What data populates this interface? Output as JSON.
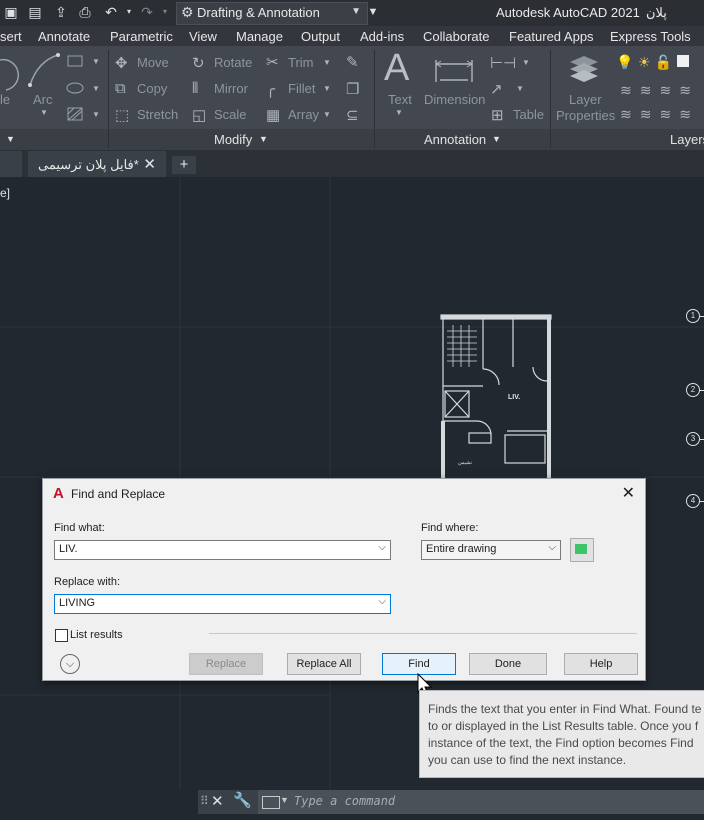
{
  "titlebar": {
    "workspace": "Drafting & Annotation",
    "app_name": "Autodesk AutoCAD 2021",
    "file_title": "پلان ترسیمی"
  },
  "menu": [
    "sert",
    "Annotate",
    "Parametric",
    "View",
    "Manage",
    "Output",
    "Add-ins",
    "Collaborate",
    "Featured Apps",
    "Express Tools"
  ],
  "ribbon": {
    "draw_partial": [
      "le",
      "Arc"
    ],
    "modify": {
      "move": "Move",
      "rotate": "Rotate",
      "trim": "Trim",
      "copy": "Copy",
      "mirror": "Mirror",
      "fillet": "Fillet",
      "stretch": "Stretch",
      "scale": "Scale",
      "array": "Array",
      "panel_label": "Modify"
    },
    "annotation": {
      "text": "Text",
      "dimension": "Dimension",
      "table": "Table",
      "panel_label": "Annotation"
    },
    "layers": {
      "layer_properties_1": "Layer",
      "layer_properties_2": "Properties",
      "panel_label": "Layers"
    }
  },
  "doc_tab": {
    "label": "فایل پلان ترسیمی*",
    "close": "✕",
    "add": "+"
  },
  "viewport": {
    "tag": "e]"
  },
  "drawing": {
    "room_label_1": "LIV.",
    "room_label_2": "نشیمن",
    "grid_marks": [
      "1",
      "2",
      "3",
      "4"
    ]
  },
  "dialog": {
    "title": "Find and Replace",
    "find_what_label": "Find what:",
    "find_what_value": "LIV.",
    "replace_with_label": "Replace with:",
    "replace_with_value": "LIVING",
    "find_where_label": "Find where:",
    "find_where_value": "Entire drawing",
    "list_results_label": "List results",
    "buttons": {
      "replace": "Replace",
      "replace_all": "Replace All",
      "find": "Find",
      "done": "Done",
      "help": "Help"
    }
  },
  "tooltip": {
    "lines": [
      "Finds the text that you enter in Find What. Found te",
      "to or displayed in the List Results table. Once you f",
      "instance of the text, the Find option becomes Find",
      "you can use to find the next instance."
    ]
  },
  "command_line": {
    "placeholder": "Type a command"
  },
  "colors": {
    "canvas": "#212830",
    "ribbon": "#434850",
    "dialog": "#f0f0f0",
    "find_button_border": "#0078d7",
    "autocad_red": "#c8102e"
  }
}
